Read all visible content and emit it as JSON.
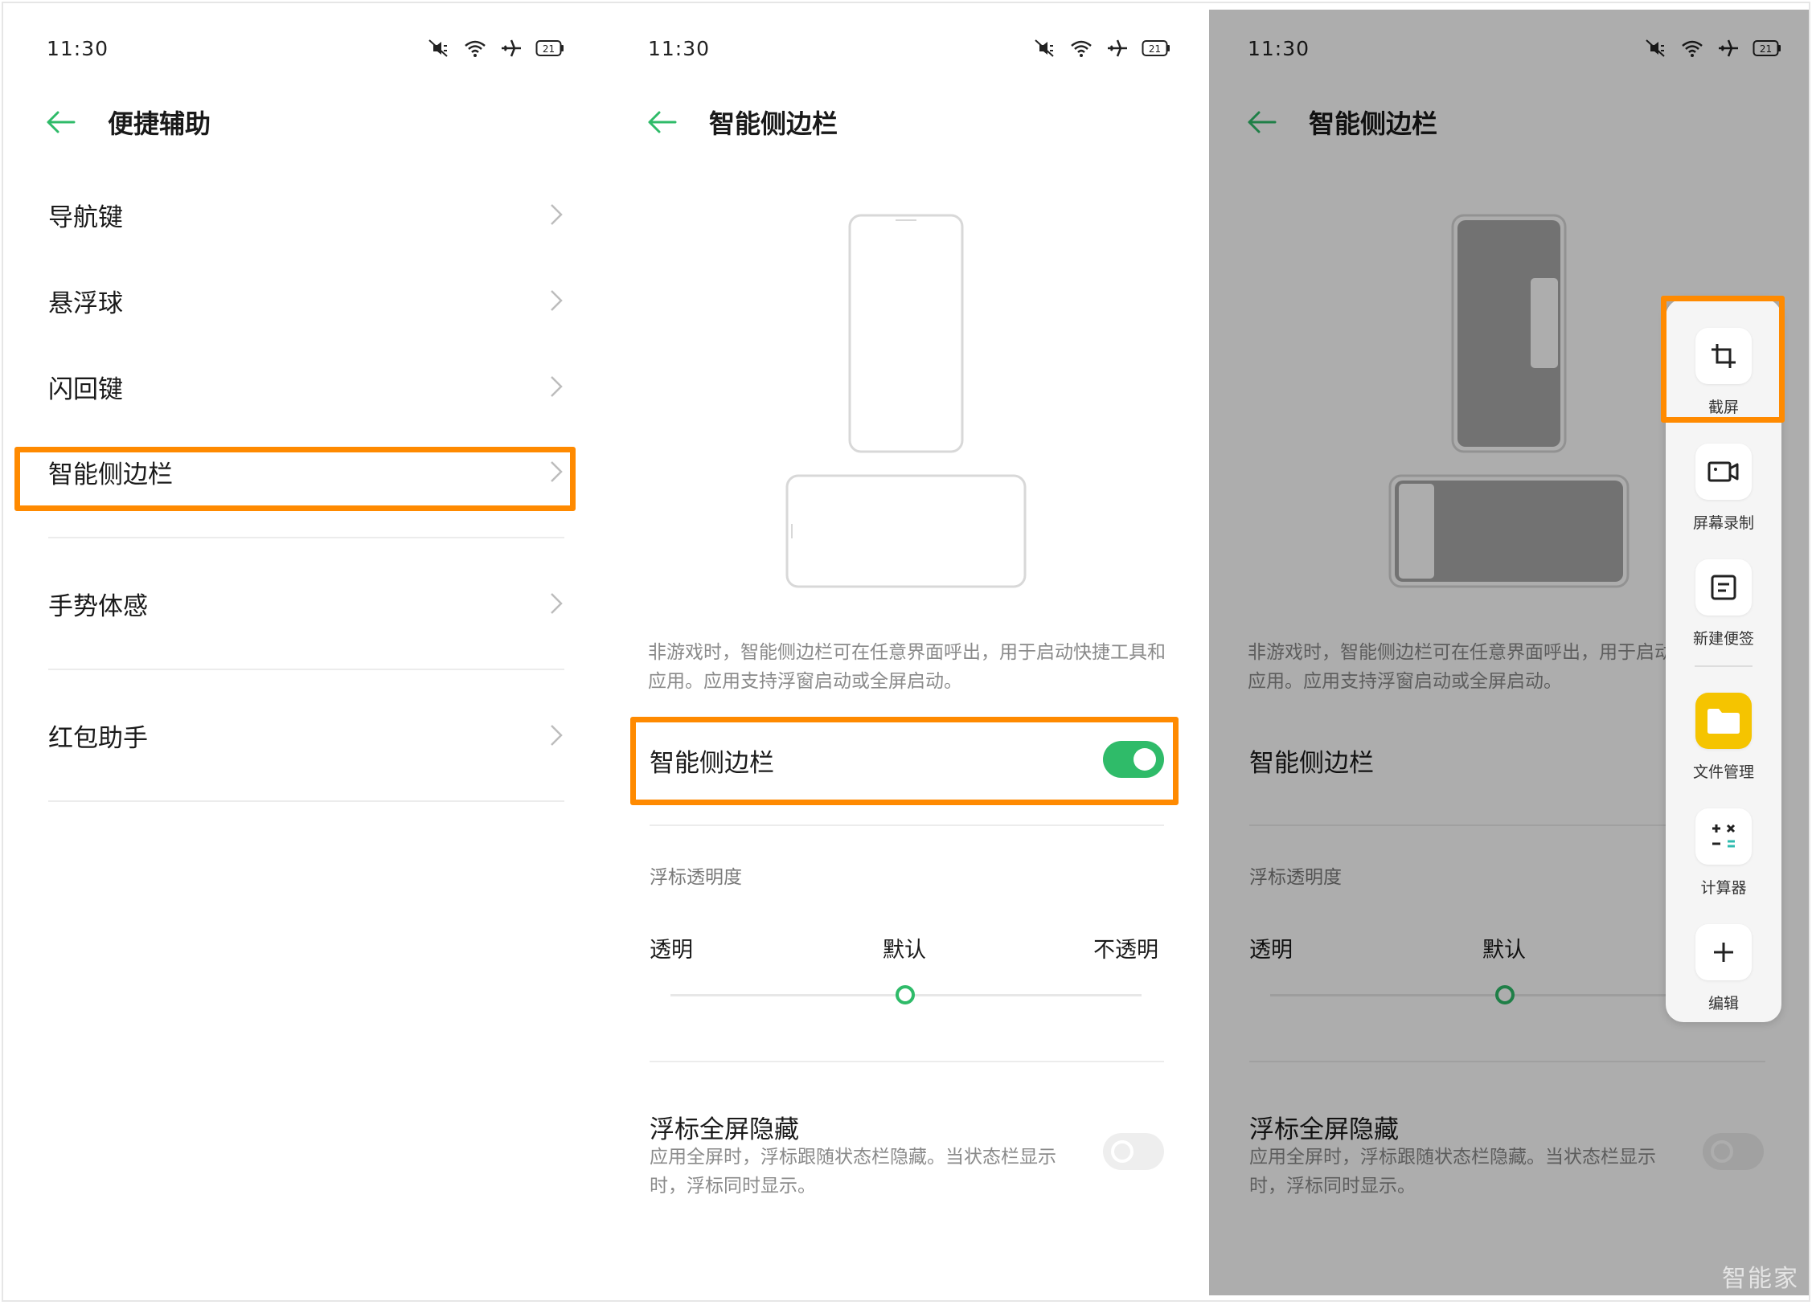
{
  "statusbar": {
    "time": "11:30",
    "battery": "21"
  },
  "panel1": {
    "title": "便捷辅助",
    "items": [
      "导航键",
      "悬浮球",
      "闪回键",
      "智能侧边栏",
      "手势体感",
      "红包助手"
    ]
  },
  "panel2": {
    "title": "智能侧边栏",
    "description": "非游戏时，智能侧边栏可在任意界面呼出，用于启动快捷工具和应用。应用支持浮窗启动或全屏启动。",
    "toggle_label": "智能侧边栏",
    "toggle_on": true,
    "opacity": {
      "section": "浮标透明度",
      "labels": [
        "透明",
        "默认",
        "不透明"
      ],
      "value_label": "默认"
    },
    "hide_row": {
      "title": "浮标全屏隐藏",
      "desc": "应用全屏时，浮标跟随状态栏隐藏。当状态栏显示时，浮标同时显示。",
      "toggle_on": false
    }
  },
  "panel3": {
    "title": "智能侧边栏",
    "description": "非游戏时，智能侧边栏可在任意界面呼出，用于启动快捷工具和应用。应用支持浮窗启动或全屏启动。",
    "toggle_label": "智能侧边栏",
    "opacity_section": "浮标透明度",
    "opacity_labels": [
      "透明",
      "默认"
    ],
    "hide_title": "浮标全屏隐藏",
    "hide_desc": "应用全屏时，浮标跟随状态栏隐藏。当状态栏显示时，浮标同时显示。",
    "sidebar_items": [
      {
        "label": "截屏",
        "icon": "crop-icon"
      },
      {
        "label": "屏幕录制",
        "icon": "screen-record-icon"
      },
      {
        "label": "新建便签",
        "icon": "note-icon"
      },
      {
        "label": "文件管理",
        "icon": "folder-icon"
      },
      {
        "label": "计算器",
        "icon": "calculator-icon"
      },
      {
        "label": "编辑",
        "icon": "plus-icon"
      }
    ]
  },
  "watermark": "智能家",
  "colors": {
    "accent": "#2fbb69",
    "highlight": "#ff8a00",
    "folder": "#f5c400"
  }
}
